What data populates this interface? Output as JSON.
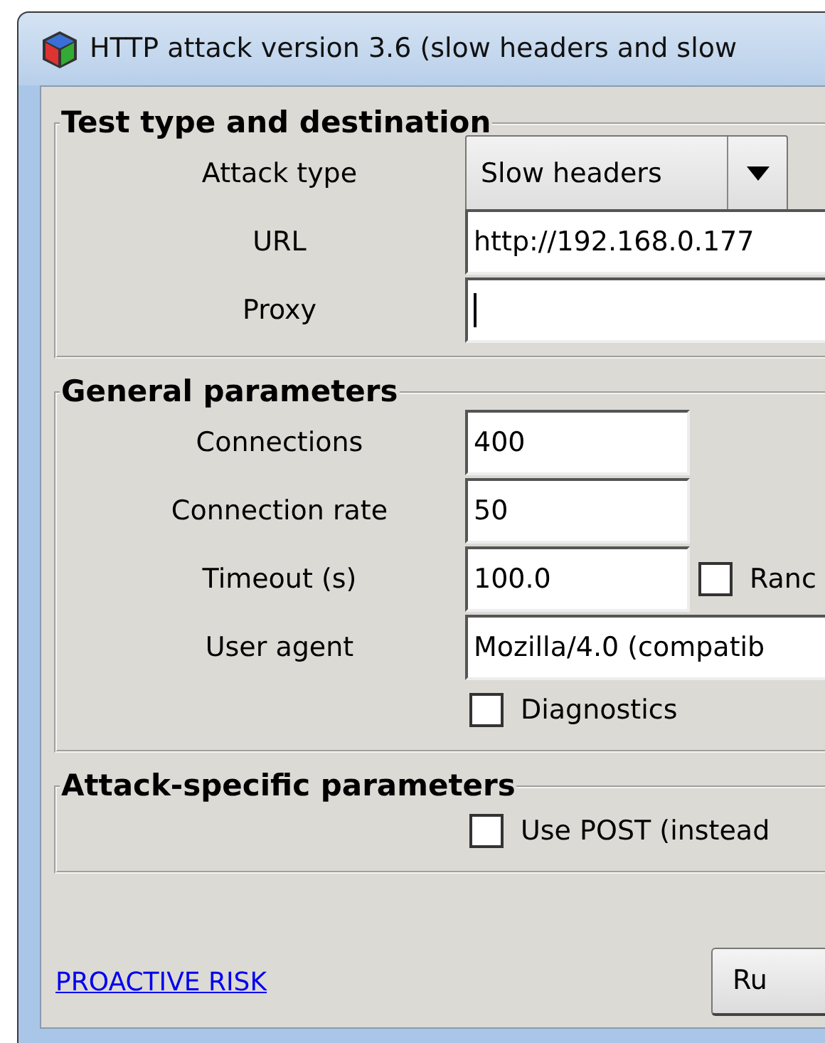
{
  "window": {
    "title": "HTTP attack version 3.6 (slow headers and slow"
  },
  "groups": [
    {
      "title": "Test type and destination",
      "rows": [
        {
          "kind": "combo",
          "label": "Attack type",
          "value": "Slow headers"
        },
        {
          "kind": "field",
          "label": "URL",
          "value": "http://192.168.0.177"
        },
        {
          "kind": "field",
          "label": "Proxy",
          "focused": true
        }
      ]
    },
    {
      "title": "General parameters",
      "rows": [
        {
          "kind": "short-field",
          "label": "Connections",
          "value": "400"
        },
        {
          "kind": "short-field",
          "label": "Connection rate",
          "value": "50"
        },
        {
          "kind": "short-field",
          "label": "Timeout (s)",
          "value": "100.0",
          "checkbox": {
            "label": "Ranc",
            "checked": false
          }
        },
        {
          "kind": "field",
          "label": "User agent",
          "value": "Mozilla/4.0 (compatib"
        },
        {
          "kind": "checkbox",
          "checkbox": {
            "label": "Diagnostics",
            "checked": false
          }
        }
      ]
    },
    {
      "title": "Attack-specific parameters",
      "rows": [
        {
          "kind": "checkbox",
          "checkbox": {
            "label": "Use POST (instead",
            "checked": false
          }
        }
      ]
    }
  ],
  "footer": {
    "link": "PROACTIVE RISK",
    "button": "Ru"
  }
}
